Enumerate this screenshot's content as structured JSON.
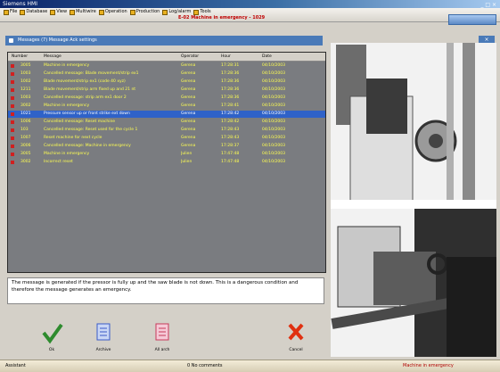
{
  "window": {
    "title": "Siemens HMI"
  },
  "menubar": {
    "items": [
      "File",
      "Database",
      "View",
      "Multiwire",
      "Operation",
      "Production",
      "Log/alarm",
      "Tools"
    ],
    "alarm_text": "E-02 Machine in emergency - 1029"
  },
  "messages_pane": {
    "title": "Messages (7)    Message Ack settings",
    "columns": [
      "Number",
      "Message",
      "Operator",
      "Hour",
      "Date"
    ],
    "rows": [
      {
        "number": "3005",
        "message": "Machine in emergency",
        "operator": "Gerena",
        "hour": "17:28:31",
        "date": "04/10/2003"
      },
      {
        "number": "1003",
        "message": "Cancelled message: Blade movement/strip ex1",
        "operator": "Gerena",
        "hour": "17:28:36",
        "date": "04/10/2003"
      },
      {
        "number": "1002",
        "message": "Blade movement/strip ex1 (code 40 xyz)",
        "operator": "Gerena",
        "hour": "17:28:36",
        "date": "04/10/2003"
      },
      {
        "number": "1211",
        "message": "Blade movement/strip arm fixed up and 21 nt",
        "operator": "Gerena",
        "hour": "17:28:36",
        "date": "04/10/2003"
      },
      {
        "number": "1003",
        "message": "Cancelled message: strip arm ex1 door 2",
        "operator": "Gerena",
        "hour": "17:28:36",
        "date": "04/10/2003"
      },
      {
        "number": "3002",
        "message": "Machine in emergency",
        "operator": "Gerena",
        "hour": "17:28:41",
        "date": "04/10/2003"
      },
      {
        "number": "1021",
        "message": "Pressure sensor up or front strike ext down",
        "operator": "Gerena",
        "hour": "17:28:42",
        "date": "04/10/2003"
      },
      {
        "number": "1006",
        "message": "Cancelled message: Reset machine",
        "operator": "Gerena",
        "hour": "17:28:42",
        "date": "04/10/2003"
      },
      {
        "number": "103",
        "message": "Cancelled message: Reset used for the cycle 1",
        "operator": "Gerena",
        "hour": "17:28:43",
        "date": "04/10/2003"
      },
      {
        "number": "1007",
        "message": "Reset machine for next cycle",
        "operator": "Gerena",
        "hour": "17:28:43",
        "date": "04/10/2003"
      },
      {
        "number": "3006",
        "message": "Cancelled message: Machine in emergency",
        "operator": "Gerena",
        "hour": "17:28:37",
        "date": "04/10/2003"
      },
      {
        "number": "3005",
        "message": "Machine in emergency",
        "operator": "Julien",
        "hour": "17:47:48",
        "date": "04/10/2003"
      },
      {
        "number": "3002",
        "message": "Incorrect reset",
        "operator": "Julien",
        "hour": "17:47:48",
        "date": "04/10/2003"
      }
    ],
    "selected_index": 6,
    "description": "The message is generated if the pressor is fully up and the saw blade is not down. This is a dangerous condition and therefore the message generates an emergency."
  },
  "buttons": [
    {
      "label": "Ok",
      "icon": "checkmark-icon",
      "color": "#2e8b2e"
    },
    {
      "label": "Archive",
      "icon": "archive-icon",
      "color": "#3a5bc8"
    },
    {
      "label": "All arch",
      "icon": "all-archive-icon",
      "color": "#c83a5b"
    },
    {
      "label": "Cancel",
      "icon": "cancel-x-icon",
      "color": "#e03010"
    }
  ],
  "statusbar": {
    "left": "Assistant",
    "center": "0 No comments",
    "right": "Machine in emergency"
  }
}
